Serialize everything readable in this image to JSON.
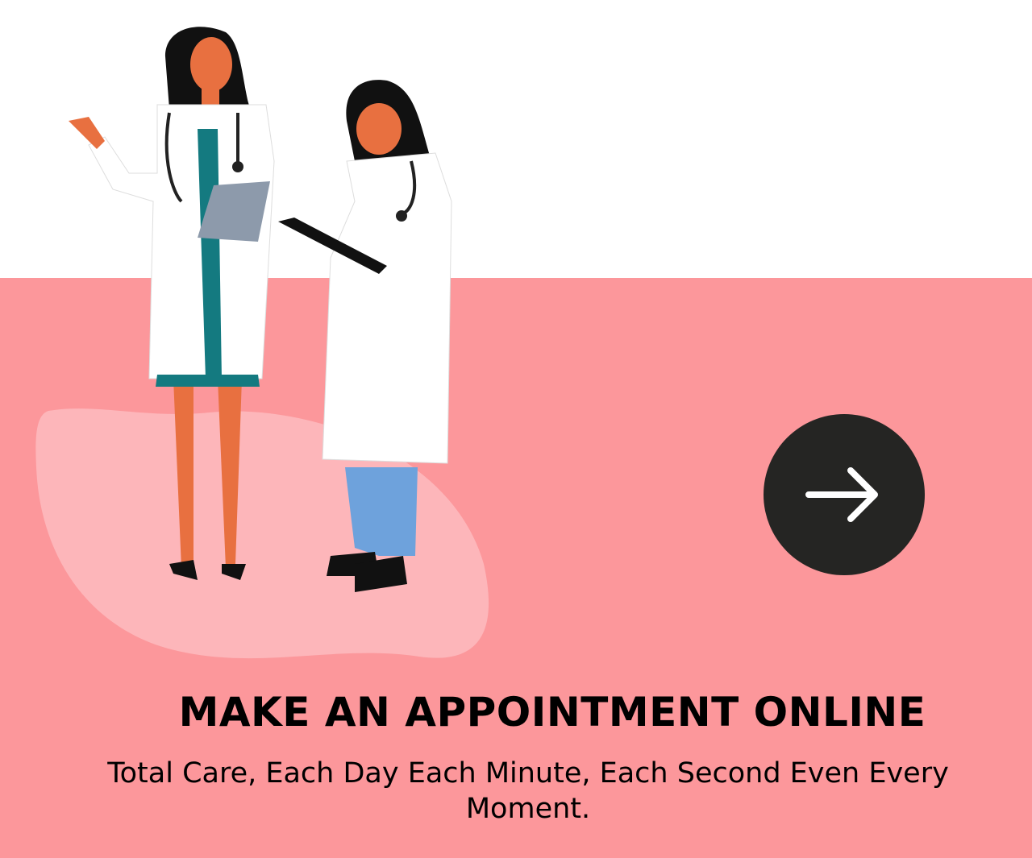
{
  "hero": {
    "title": "MAKE AN APPOINTMENT ONLINE",
    "subtitle": "Total Care, Each Day Each Minute, Each Second Even Every Moment.",
    "next_button_icon": "arrow-right-icon",
    "illustration": "two-doctors-illustration"
  },
  "colors": {
    "background_band": "#fc979b",
    "button": "#252523"
  }
}
